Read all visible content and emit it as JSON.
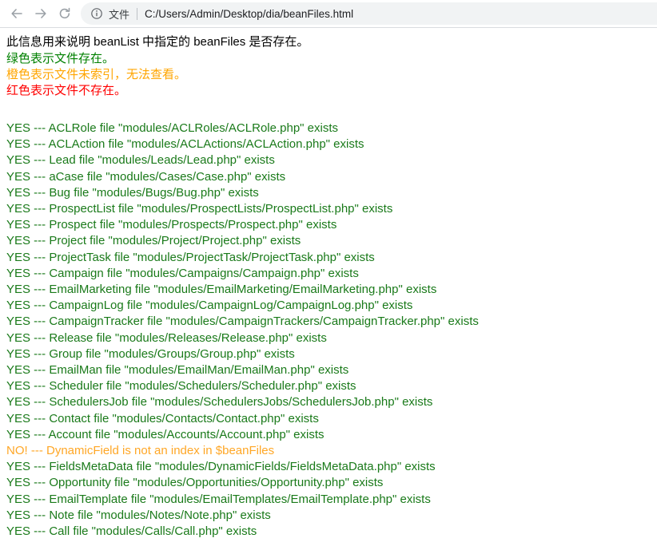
{
  "browser": {
    "back_label": "Back",
    "forward_label": "Forward",
    "reload_label": "Reload",
    "site_info_icon": "info-circle-icon",
    "scheme_label": "文件",
    "url": "C:/Users/Admin/Desktop/dia/beanFiles.html"
  },
  "colors": {
    "exists_green": "#1a7a1a",
    "not_indexed_orange": "#ffa726",
    "missing_red": "#ff0000",
    "legend_green": "#008000",
    "legend_orange": "#ffa500",
    "legend_red": "#ff0000",
    "text_black": "#000000",
    "omnibox_bg": "#f1f3f4"
  },
  "page": {
    "intro": "此信息用来说明 beanList 中指定的 beanFiles 是否存在。",
    "legend_green": "绿色表示文件存在。",
    "legend_orange": "橙色表示文件未索引，无法查看。",
    "legend_red": "红色表示文件不存在。"
  },
  "results": [
    {
      "status": "ok",
      "text": "YES --- ACLRole file \"modules/ACLRoles/ACLRole.php\" exists"
    },
    {
      "status": "ok",
      "text": "YES --- ACLAction file \"modules/ACLActions/ACLAction.php\" exists"
    },
    {
      "status": "ok",
      "text": "YES --- Lead file \"modules/Leads/Lead.php\" exists"
    },
    {
      "status": "ok",
      "text": "YES --- aCase file \"modules/Cases/Case.php\" exists"
    },
    {
      "status": "ok",
      "text": "YES --- Bug file \"modules/Bugs/Bug.php\" exists"
    },
    {
      "status": "ok",
      "text": "YES --- ProspectList file \"modules/ProspectLists/ProspectList.php\" exists"
    },
    {
      "status": "ok",
      "text": "YES --- Prospect file \"modules/Prospects/Prospect.php\" exists"
    },
    {
      "status": "ok",
      "text": "YES --- Project file \"modules/Project/Project.php\" exists"
    },
    {
      "status": "ok",
      "text": "YES --- ProjectTask file \"modules/ProjectTask/ProjectTask.php\" exists"
    },
    {
      "status": "ok",
      "text": "YES --- Campaign file \"modules/Campaigns/Campaign.php\" exists"
    },
    {
      "status": "ok",
      "text": "YES --- EmailMarketing file \"modules/EmailMarketing/EmailMarketing.php\" exists"
    },
    {
      "status": "ok",
      "text": "YES --- CampaignLog file \"modules/CampaignLog/CampaignLog.php\" exists"
    },
    {
      "status": "ok",
      "text": "YES --- CampaignTracker file \"modules/CampaignTrackers/CampaignTracker.php\" exists"
    },
    {
      "status": "ok",
      "text": "YES --- Release file \"modules/Releases/Release.php\" exists"
    },
    {
      "status": "ok",
      "text": "YES --- Group file \"modules/Groups/Group.php\" exists"
    },
    {
      "status": "ok",
      "text": "YES --- EmailMan file \"modules/EmailMan/EmailMan.php\" exists"
    },
    {
      "status": "ok",
      "text": "YES --- Scheduler file \"modules/Schedulers/Scheduler.php\" exists"
    },
    {
      "status": "ok",
      "text": "YES --- SchedulersJob file \"modules/SchedulersJobs/SchedulersJob.php\" exists"
    },
    {
      "status": "ok",
      "text": "YES --- Contact file \"modules/Contacts/Contact.php\" exists"
    },
    {
      "status": "ok",
      "text": "YES --- Account file \"modules/Accounts/Account.php\" exists"
    },
    {
      "status": "warn",
      "text": "NO! --- DynamicField is not an index in $beanFiles"
    },
    {
      "status": "ok",
      "text": "YES --- FieldsMetaData file \"modules/DynamicFields/FieldsMetaData.php\" exists"
    },
    {
      "status": "ok",
      "text": "YES --- Opportunity file \"modules/Opportunities/Opportunity.php\" exists"
    },
    {
      "status": "ok",
      "text": "YES --- EmailTemplate file \"modules/EmailTemplates/EmailTemplate.php\" exists"
    },
    {
      "status": "ok",
      "text": "YES --- Note file \"modules/Notes/Note.php\" exists"
    },
    {
      "status": "ok",
      "text": "YES --- Call file \"modules/Calls/Call.php\" exists"
    }
  ]
}
